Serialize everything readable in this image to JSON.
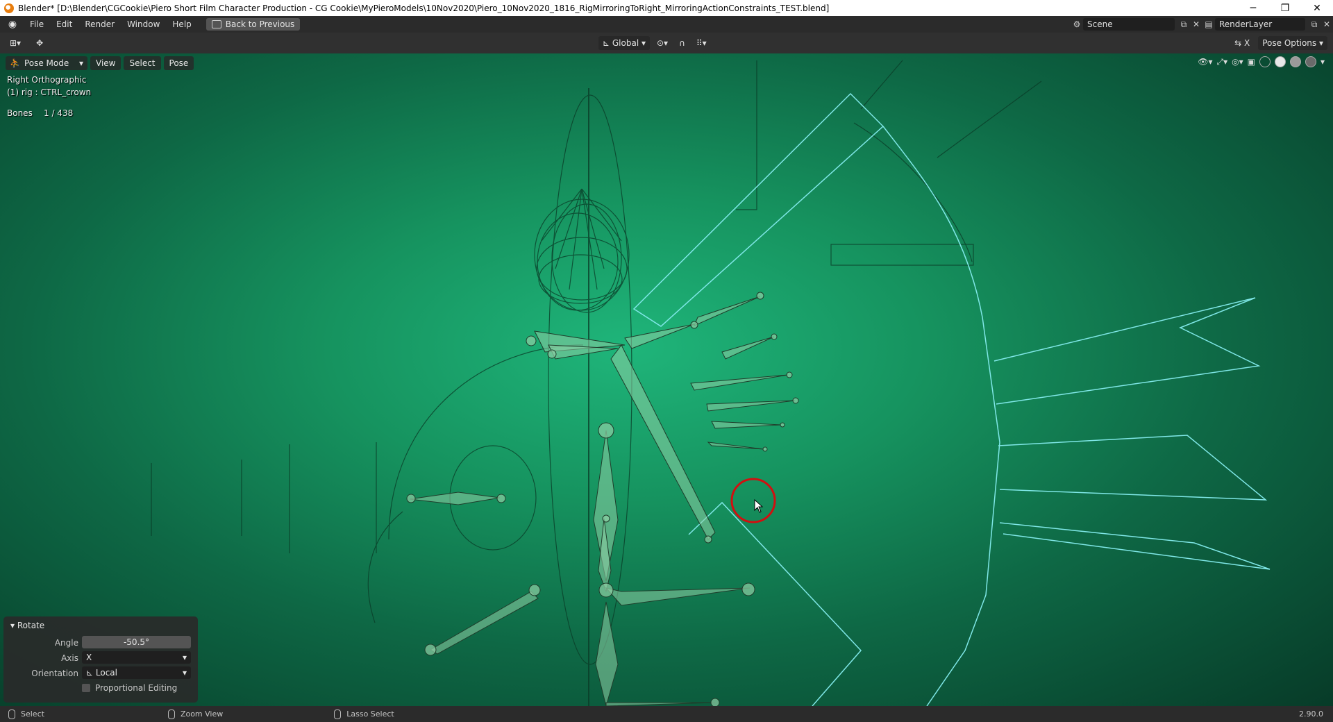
{
  "window": {
    "title": "Blender* [D:\\Blender\\CGCookie\\Piero Short Film Character Production - CG Cookie\\MyPieroModels\\10Nov2020\\Piero_10Nov2020_1816_RigMirroringToRight_MirroringActionConstraints_TEST.blend]",
    "minimize": "─",
    "restore": "❐",
    "close": "✕"
  },
  "menubar": {
    "items": [
      "File",
      "Edit",
      "Render",
      "Window",
      "Help"
    ],
    "back_button": "Back to Previous",
    "scene": "Scene",
    "view_layer": "RenderLayer"
  },
  "toolheader": {
    "orientation": "Global",
    "pose_options": "Pose Options"
  },
  "viewport": {
    "mode": "Pose Mode",
    "menus": [
      "View",
      "Select",
      "Pose"
    ],
    "view_name": "Right Orthographic",
    "object_info": "(1) rig : CTRL_crown",
    "bones_label": "Bones",
    "bones_count": "1 / 438"
  },
  "redo_panel": {
    "title": "Rotate",
    "angle_label": "Angle",
    "angle_value": "-50.5°",
    "axis_label": "Axis",
    "axis_value": "X",
    "orientation_label": "Orientation",
    "orientation_value": "Local",
    "proportional_label": "Proportional Editing"
  },
  "statusbar": {
    "select": "Select",
    "zoom": "Zoom View",
    "lasso": "Lasso Select",
    "version": "2.90.0"
  },
  "colors": {
    "viewport_center": "#1fb57a",
    "bone_fill": "#8fd0a5",
    "widget_cyan": "#7fe7e7",
    "cursor_ring": "#d11010"
  }
}
